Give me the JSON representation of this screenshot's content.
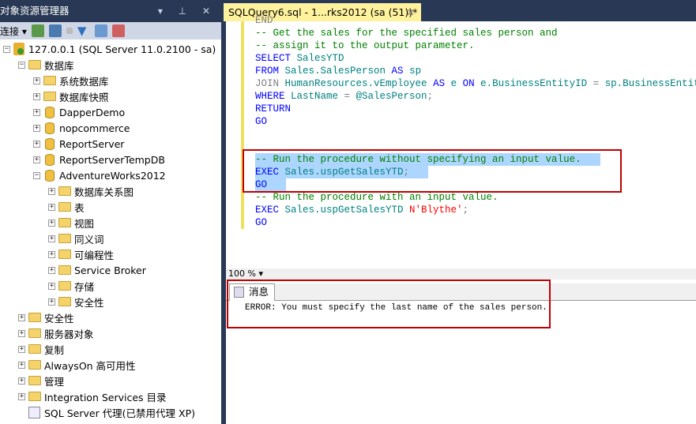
{
  "explorer": {
    "title": "对象资源管理器",
    "title_buttons": "▾ ⊥ ✕",
    "connect_label": "连接",
    "toolbar_icons": [
      "connect-icon",
      "disconnect-icon",
      "stop-icon",
      "filter-icon",
      "refresh-icon",
      "activity-monitor-icon"
    ],
    "tree": [
      {
        "label": "127.0.0.1 (SQL Server 11.0.2100 - sa)",
        "level": 0,
        "icon": "server",
        "exp": "-"
      },
      {
        "label": "数据库",
        "level": 1,
        "icon": "folder",
        "exp": "-"
      },
      {
        "label": "系统数据库",
        "level": 2,
        "icon": "folder",
        "exp": "+"
      },
      {
        "label": "数据库快照",
        "level": 2,
        "icon": "folder",
        "exp": "+"
      },
      {
        "label": "DapperDemo",
        "level": 2,
        "icon": "db",
        "exp": "+"
      },
      {
        "label": "nopcommerce",
        "level": 2,
        "icon": "db",
        "exp": "+"
      },
      {
        "label": "ReportServer",
        "level": 2,
        "icon": "db",
        "exp": "+"
      },
      {
        "label": "ReportServerTempDB",
        "level": 2,
        "icon": "db",
        "exp": "+"
      },
      {
        "label": "AdventureWorks2012",
        "level": 2,
        "icon": "db",
        "exp": "-"
      },
      {
        "label": "数据库关系图",
        "level": 3,
        "icon": "folder",
        "exp": "+"
      },
      {
        "label": "表",
        "level": 3,
        "icon": "folder",
        "exp": "+"
      },
      {
        "label": "视图",
        "level": 3,
        "icon": "folder",
        "exp": "+"
      },
      {
        "label": "同义词",
        "level": 3,
        "icon": "folder",
        "exp": "+"
      },
      {
        "label": "可编程性",
        "level": 3,
        "icon": "folder",
        "exp": "+"
      },
      {
        "label": "Service Broker",
        "level": 3,
        "icon": "folder",
        "exp": "+"
      },
      {
        "label": "存储",
        "level": 3,
        "icon": "folder",
        "exp": "+"
      },
      {
        "label": "安全性",
        "level": 3,
        "icon": "folder",
        "exp": "+"
      },
      {
        "label": "安全性",
        "level": 1,
        "icon": "folder",
        "exp": "+"
      },
      {
        "label": "服务器对象",
        "level": 1,
        "icon": "folder",
        "exp": "+"
      },
      {
        "label": "复制",
        "level": 1,
        "icon": "folder",
        "exp": "+"
      },
      {
        "label": "AlwaysOn 高可用性",
        "level": 1,
        "icon": "folder",
        "exp": "+"
      },
      {
        "label": "管理",
        "level": 1,
        "icon": "folder",
        "exp": "+"
      },
      {
        "label": "Integration Services 目录",
        "level": 1,
        "icon": "folder",
        "exp": "+"
      },
      {
        "label": "SQL Server 代理(已禁用代理 XP)",
        "level": 1,
        "icon": "agent",
        "exp": ""
      }
    ]
  },
  "editor": {
    "tab_title": "SQLQuery6.sql - 1...rks2012 (sa (51))*",
    "tab_close": "✕",
    "lines": [
      {
        "hl": false,
        "tokens": [
          [
            "-- Get the sales for the specified sales person and",
            "cm"
          ]
        ]
      },
      {
        "hl": false,
        "tokens": [
          [
            "-- assign it to the output parameter.",
            "cm"
          ]
        ]
      },
      {
        "hl": false,
        "tokens": [
          [
            "SELECT",
            "kw"
          ],
          [
            " SalesYTD",
            "tl"
          ]
        ]
      },
      {
        "hl": false,
        "tokens": [
          [
            "FROM",
            "kw"
          ],
          [
            " Sales.SalesPerson ",
            "tl"
          ],
          [
            "AS",
            "kw"
          ],
          [
            " sp",
            "tl"
          ]
        ]
      },
      {
        "hl": false,
        "tokens": [
          [
            "JOIN",
            "gr"
          ],
          [
            " HumanResources.vEmployee ",
            "tl"
          ],
          [
            "AS",
            "kw"
          ],
          [
            " e ",
            "tl"
          ],
          [
            "ON",
            "kw"
          ],
          [
            " e.BusinessEntityID ",
            "tl"
          ],
          [
            "=",
            "gr"
          ],
          [
            " sp.BusinessEntityID",
            "tl"
          ]
        ]
      },
      {
        "hl": false,
        "tokens": [
          [
            "WHERE",
            "kw"
          ],
          [
            " LastName ",
            "tl"
          ],
          [
            "=",
            "gr"
          ],
          [
            " @SalesPerson",
            "tl"
          ],
          [
            ";",
            "gr"
          ]
        ]
      },
      {
        "hl": false,
        "tokens": [
          [
            "RETURN",
            "kw"
          ]
        ]
      },
      {
        "hl": false,
        "tokens": [
          [
            "GO",
            "kw"
          ]
        ]
      },
      {
        "hl": false,
        "tokens": []
      },
      {
        "hl": false,
        "tokens": []
      },
      {
        "hl": true,
        "tokens": [
          [
            "-- Run the procedure without specifying an input value.",
            "cm"
          ]
        ]
      },
      {
        "hl": true,
        "tokens": [
          [
            "EXEC",
            "kw"
          ],
          [
            " Sales.uspGetSalesYTD",
            "tl"
          ],
          [
            ";",
            "gr"
          ]
        ]
      },
      {
        "hl": true,
        "tokens": [
          [
            "GO",
            "kw"
          ]
        ]
      },
      {
        "hl": false,
        "tokens": [
          [
            "-- Run the procedure with an input value.",
            "cm"
          ]
        ]
      },
      {
        "hl": false,
        "tokens": [
          [
            "EXEC",
            "kw"
          ],
          [
            " Sales.uspGetSalesYTD ",
            "tl"
          ],
          [
            "N'Blythe'",
            "st"
          ],
          [
            ";",
            "gr"
          ]
        ]
      },
      {
        "hl": false,
        "tokens": [
          [
            "GO",
            "kw"
          ]
        ]
      }
    ],
    "zoom": "100 %"
  },
  "results": {
    "tab_label": "消息",
    "message": "ERROR: You must specify the last name of the sales person."
  }
}
